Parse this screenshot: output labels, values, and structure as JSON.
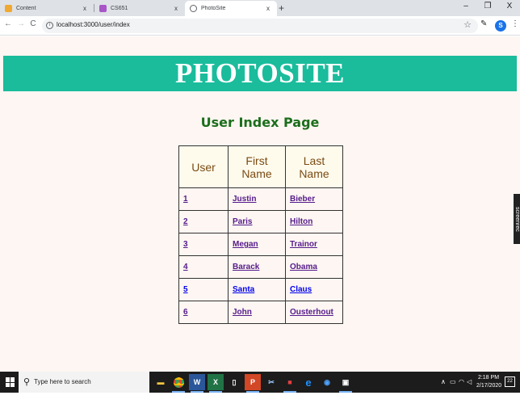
{
  "browser": {
    "tabs": [
      {
        "title": "Content",
        "close": "x",
        "favicon_color": "#f0a830",
        "active": false
      },
      {
        "title": "CS651",
        "close": "x",
        "favicon_color": "#a855c8",
        "active": false
      },
      {
        "title": "PhotoSite",
        "close": "x",
        "favicon_color": "#5f6368",
        "active": true
      }
    ],
    "new_tab": "+",
    "window_controls": {
      "minimize": "–",
      "maximize": "❐",
      "close": "X"
    },
    "nav": {
      "back": "←",
      "forward": "→",
      "reload": "C"
    },
    "url": "localhost:3000/user/index",
    "bookmark_icon": "☆",
    "profile_initial": "S",
    "menu_icon": "⋮",
    "extension_icon": "✎"
  },
  "page": {
    "banner_title": "PHOTOSITE",
    "heading": "User Index Page",
    "table": {
      "headers": [
        "User",
        "First Name",
        "Last Name"
      ],
      "rows": [
        {
          "id": "1",
          "first": "Justin",
          "last": "Bieber"
        },
        {
          "id": "2",
          "first": "Paris",
          "last": "Hilton"
        },
        {
          "id": "3",
          "first": "Megan",
          "last": "Trainor"
        },
        {
          "id": "4",
          "first": "Barack",
          "last": "Obama"
        },
        {
          "id": "5",
          "first": "Santa",
          "last": "Claus"
        },
        {
          "id": "6",
          "first": "John",
          "last": "Ousterhout"
        }
      ]
    },
    "screenrec_label": "screenrec"
  },
  "taskbar": {
    "search_placeholder": "Type here to search",
    "clock_time": "2:18 PM",
    "clock_date": "2/17/2020",
    "notifications_count": "22",
    "tray_chevron": "∧"
  },
  "colors": {
    "banner": "#1abc9c",
    "heading": "#1b6e1b",
    "page_bg": "#fdf6f2",
    "header_cell_bg": "#fefbed",
    "link_visited": "#551a8b",
    "link_unvisited": "#0000ee"
  }
}
